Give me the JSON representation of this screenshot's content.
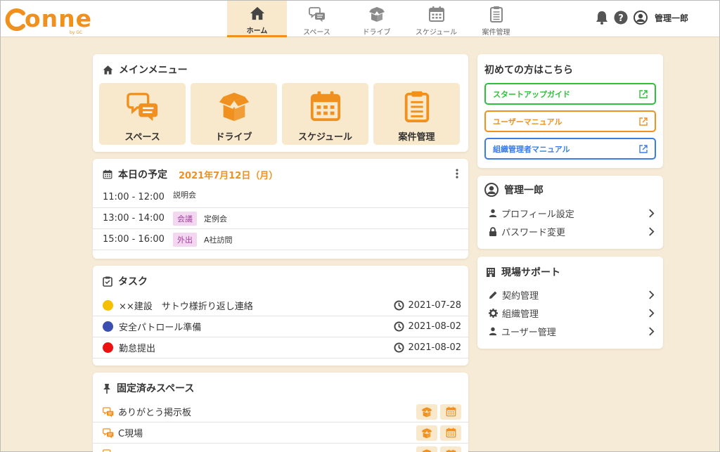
{
  "header": {
    "logo_text": "onne",
    "logo_by": "by GC",
    "nav": [
      {
        "label": "ホーム",
        "icon": "home-icon",
        "active": true
      },
      {
        "label": "スペース",
        "icon": "chat-bubbles-icon",
        "active": false
      },
      {
        "label": "ドライブ",
        "icon": "box-icon",
        "active": false
      },
      {
        "label": "スケジュール",
        "icon": "calendar-icon",
        "active": false
      },
      {
        "label": "案件管理",
        "icon": "clipboard-icon",
        "active": false
      }
    ],
    "user_name": "管理一郎"
  },
  "main_menu": {
    "title": "メインメニュー",
    "tiles": [
      {
        "label": "スペース",
        "icon": "chat-bubbles-icon"
      },
      {
        "label": "ドライブ",
        "icon": "box-icon"
      },
      {
        "label": "スケジュール",
        "icon": "calendar-icon"
      },
      {
        "label": "案件管理",
        "icon": "clipboard-icon"
      }
    ]
  },
  "today": {
    "title": "本日の予定",
    "date": "2021年7月12日（月）",
    "events": [
      {
        "time": "11:00 - 12:00",
        "tag": "",
        "name": "説明会"
      },
      {
        "time": "13:00 - 14:00",
        "tag": "会議",
        "name": "定例会"
      },
      {
        "time": "15:00 - 16:00",
        "tag": "外出",
        "name": "A社訪問"
      }
    ]
  },
  "tasks": {
    "title": "タスク",
    "items": [
      {
        "name": "××建設　サトウ様折り返し連絡",
        "date": "2021-07-28",
        "color": "#f5c000"
      },
      {
        "name": "安全パトロール準備",
        "date": "2021-08-02",
        "color": "#3b4fb0"
      },
      {
        "name": "勤怠提出",
        "date": "2021-08-02",
        "color": "#ee1111"
      }
    ]
  },
  "pinned": {
    "title": "固定済みスペース",
    "items": [
      {
        "name": "ありがとう掲示板"
      },
      {
        "name": "C現場"
      }
    ]
  },
  "beginners": {
    "title": "初めての方はこちら",
    "links": [
      {
        "label": "スタートアップガイド",
        "color": "#2fc03a"
      },
      {
        "label": "ユーザーマニュアル",
        "color": "#f0901e"
      },
      {
        "label": "組織管理者マニュアル",
        "color": "#3b7de8"
      }
    ]
  },
  "profile": {
    "name": "管理一郎",
    "items": [
      {
        "label": "プロフィール設定",
        "icon": "person-icon"
      },
      {
        "label": "パスワード変更",
        "icon": "lock-icon"
      }
    ]
  },
  "support": {
    "title": "現場サポート",
    "items": [
      {
        "label": "契約管理",
        "icon": "pencil-icon"
      },
      {
        "label": "組織管理",
        "icon": "gear-icon"
      },
      {
        "label": "ユーザー管理",
        "icon": "person-icon"
      }
    ]
  },
  "colors": {
    "accent": "#f0901e",
    "tile_bg": "#f8e8cc",
    "page_bg": "#f6ebd6"
  }
}
